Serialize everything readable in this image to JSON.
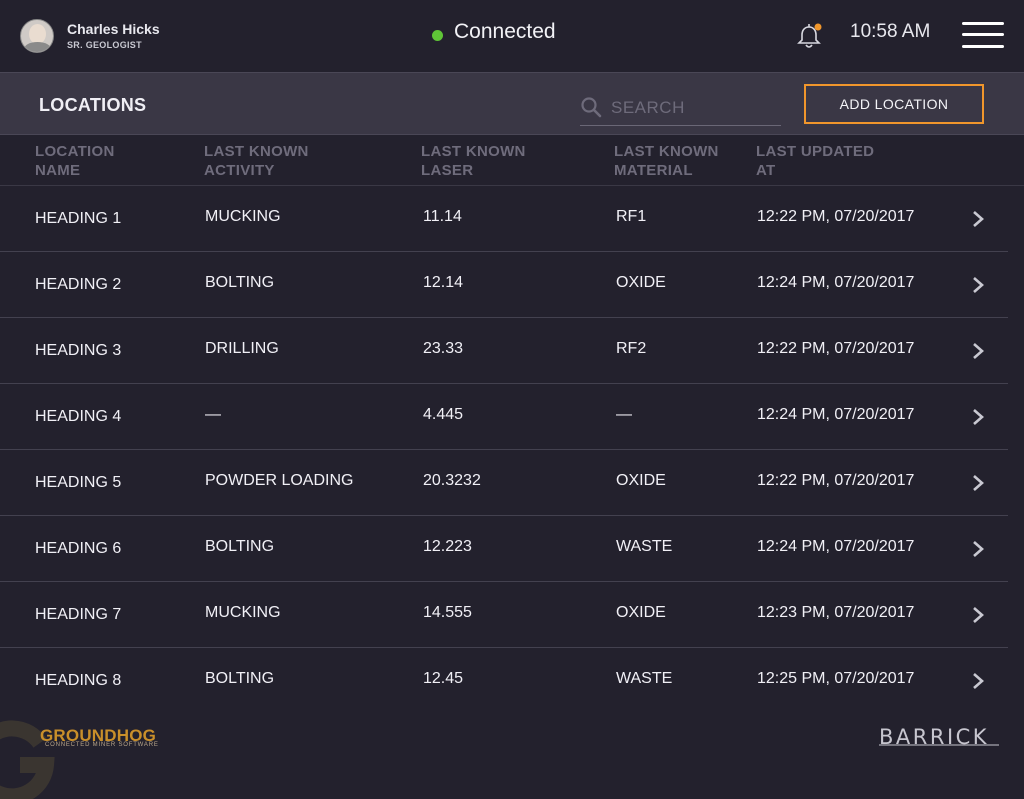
{
  "user": {
    "name": "Charles Hicks",
    "title": "SR. GEOLOGIST"
  },
  "status": {
    "text": "Connected",
    "color": "#5fc437"
  },
  "notifications": {
    "icon": "bell-icon",
    "has_unread": true,
    "badge_color": "#f0962c"
  },
  "clock": "10:58 AM",
  "menu_icon": "hamburger-menu-icon",
  "header": {
    "title": "LOCATIONS",
    "search_placeholder": "SEARCH",
    "search_value": "",
    "add_button": "ADD LOCATION",
    "accent_color": "#f0962c"
  },
  "columns": [
    {
      "line1": "LOCATION",
      "line2": "NAME"
    },
    {
      "line1": "LAST KNOWN",
      "line2": "ACTIVITY"
    },
    {
      "line1": "LAST KNOWN",
      "line2": "LASER"
    },
    {
      "line1": "LAST KNOWN",
      "line2": "MATERIAL"
    },
    {
      "line1": "LAST UPDATED",
      "line2": "AT"
    }
  ],
  "rows": [
    {
      "name": "HEADING 1",
      "activity": "MUCKING",
      "laser": "11.14",
      "material": "RF1",
      "updated": "12:22 PM, 07/20/2017"
    },
    {
      "name": "HEADING 2",
      "activity": "BOLTING",
      "laser": "12.14",
      "material": "OXIDE",
      "updated": "12:24 PM, 07/20/2017"
    },
    {
      "name": "HEADING 3",
      "activity": "DRILLING",
      "laser": "23.33",
      "material": "RF2",
      "updated": "12:22 PM, 07/20/2017"
    },
    {
      "name": "HEADING 4",
      "activity": "—",
      "laser": "4.445",
      "material": "—",
      "updated": "12:24 PM, 07/20/2017"
    },
    {
      "name": "HEADING 5",
      "activity": "POWDER LOADING",
      "laser": "20.3232",
      "material": "OXIDE",
      "updated": "12:22 PM, 07/20/2017"
    },
    {
      "name": "HEADING 6",
      "activity": "BOLTING",
      "laser": "12.223",
      "material": "WASTE",
      "updated": "12:24 PM, 07/20/2017"
    },
    {
      "name": "HEADING 7",
      "activity": "MUCKING",
      "laser": "14.555",
      "material": "OXIDE",
      "updated": "12:23 PM, 07/20/2017"
    },
    {
      "name": "HEADING 8",
      "activity": "BOLTING",
      "laser": "12.45",
      "material": "WASTE",
      "updated": "12:25 PM, 07/20/2017"
    }
  ],
  "footer": {
    "brand": "GROUNDHOG",
    "brand_sub": "CONNECTED MINER SOFTWARE",
    "partner": "BARRICK"
  }
}
